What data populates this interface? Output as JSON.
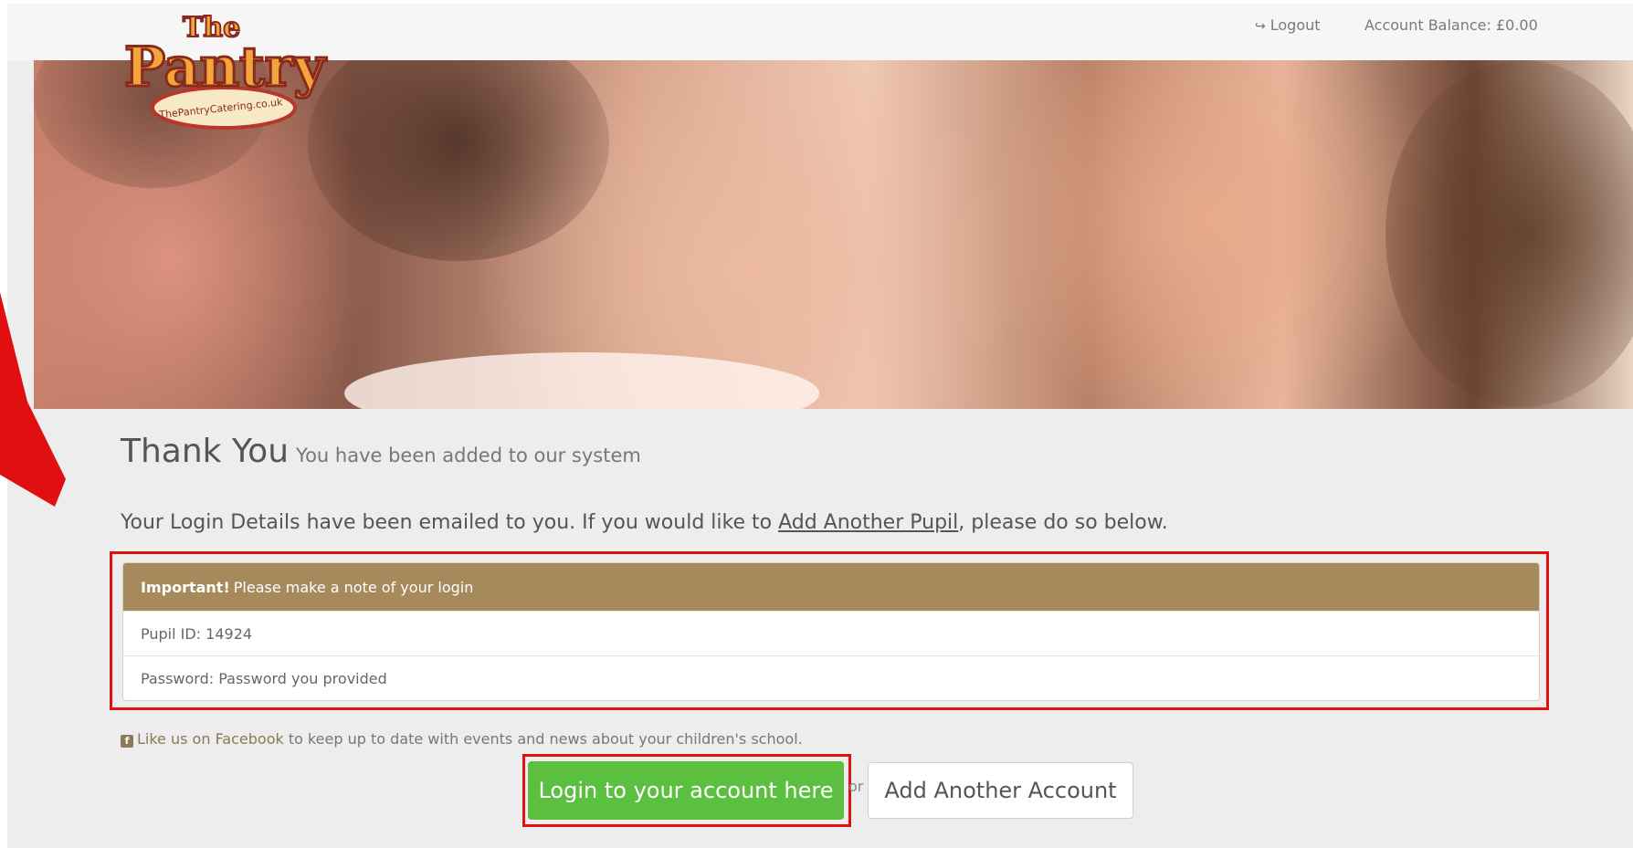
{
  "header": {
    "logout_label": "Logout",
    "balance_label": "Account Balance: £0.00",
    "logo": {
      "line1": "The",
      "line2": "Pantry",
      "ribbon": "ThePantryCatering.co.uk"
    }
  },
  "main": {
    "title": "Thank You",
    "subtitle": "You have been added to our system",
    "intro_before": "Your Login Details have been emailed to you. If you would like to ",
    "intro_link": "Add Another Pupil",
    "intro_after": ", please do so below.",
    "panel": {
      "important": "Important!",
      "heading": " Please make a note of your login",
      "pupil_id": "Pupil ID: 14924",
      "password": "Password: Password you provided"
    },
    "facebook": {
      "link": "Like us on Facebook",
      "text": " to keep up to date with events and news about your children's school."
    },
    "buttons": {
      "login": "Login to your account here",
      "or": "or",
      "add_account": "Add Another Account"
    }
  },
  "colors": {
    "panel_header": "#a68a5c",
    "login_button": "#5bbf3f",
    "highlight": "#e01010",
    "page_background": "#ededed"
  }
}
